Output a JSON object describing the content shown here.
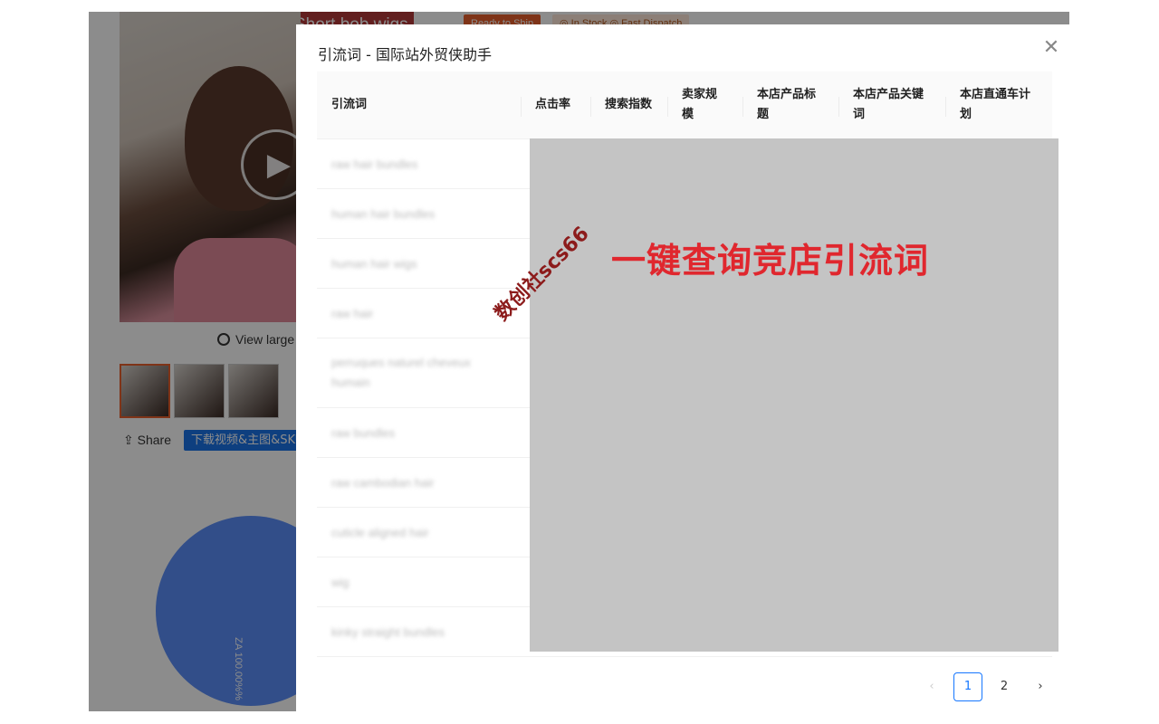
{
  "background": {
    "title": "Short bob wigs",
    "badge_ready": "Ready to Ship",
    "badge_stock": "◎ In Stock  ◎ Fast Dispatch",
    "view_large": "View large",
    "share": "Share",
    "download_button": "下载视频&主图&SKU",
    "pie_label": "ZA 100.00%%"
  },
  "modal": {
    "title": "引流词 - 国际站外贸侠助手",
    "columns": [
      "引流词",
      "点击率",
      "搜索指数",
      "卖家规模",
      "本店产品标题",
      "本店产品关键词",
      "本店直通车计划"
    ],
    "rows": [
      {
        "keyword": "raw hair bundles"
      },
      {
        "keyword": "human hair bundles"
      },
      {
        "keyword": "human hair wigs"
      },
      {
        "keyword": "raw hair"
      },
      {
        "keyword": "perruques naturel cheveux humain"
      },
      {
        "keyword": "raw bundles"
      },
      {
        "keyword": "raw cambodian hair"
      },
      {
        "keyword": "cuticle aligned hair"
      },
      {
        "keyword": "wig"
      },
      {
        "keyword": "kinky straight bundles"
      }
    ],
    "promo_text": "一键查询竞店引流词",
    "watermark": "数创社scs66",
    "pagination": {
      "prev": "‹",
      "pages": [
        "1",
        "2"
      ],
      "current": "1",
      "next": "›"
    },
    "close_icon": "close-icon"
  }
}
